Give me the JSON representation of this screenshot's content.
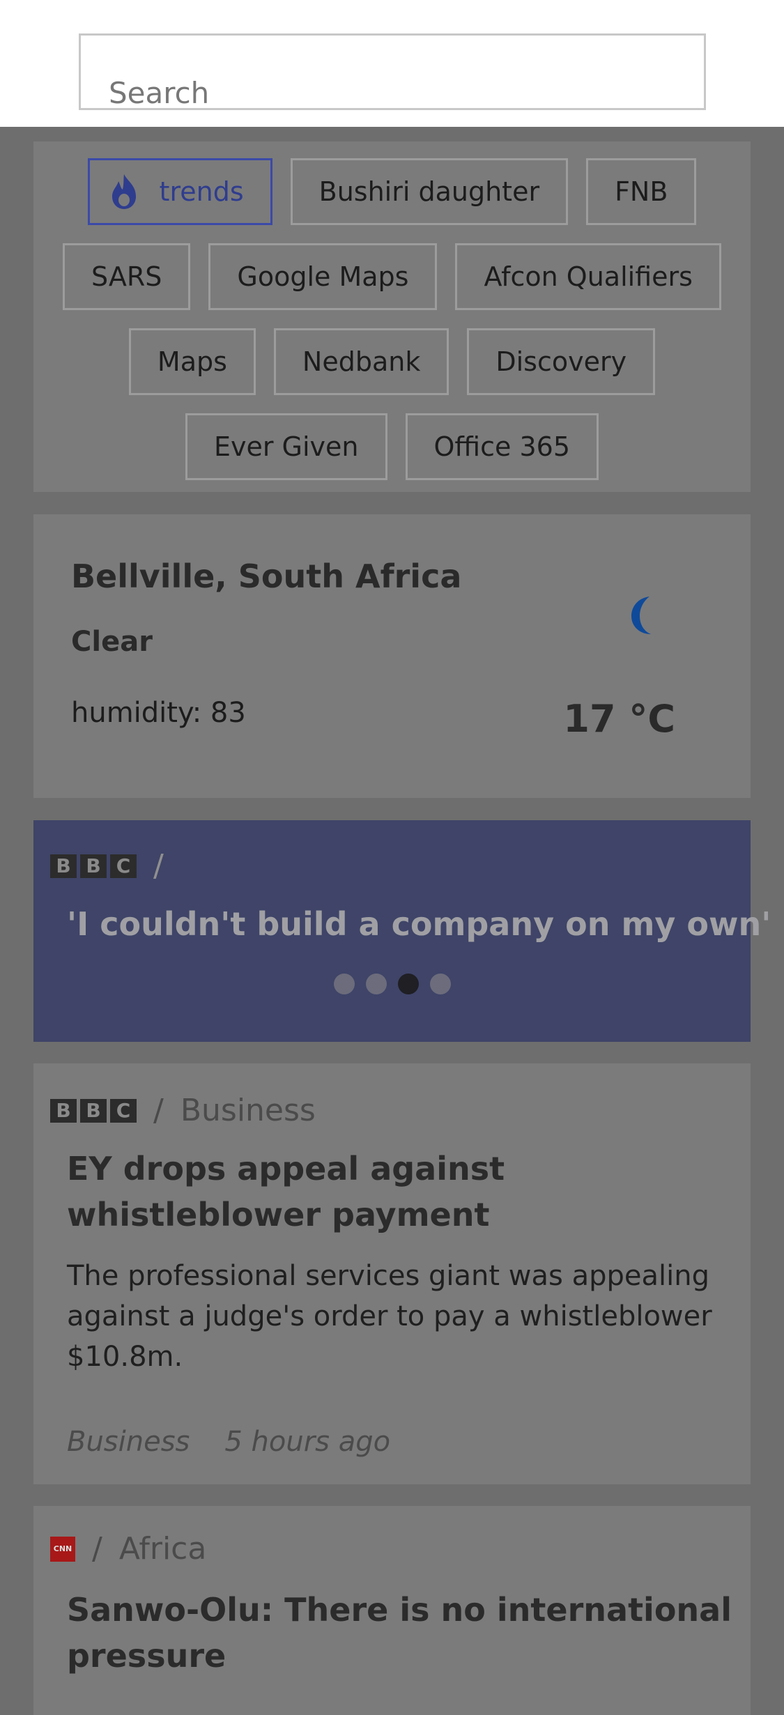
{
  "search": {
    "placeholder": "Search"
  },
  "trends": {
    "rows": [
      [
        {
          "label": "trends"
        },
        {
          "label": "Bushiri daughter"
        },
        {
          "label": "FNB"
        }
      ],
      [
        {
          "label": "SARS"
        },
        {
          "label": "Google Maps"
        },
        {
          "label": "Afcon Qualifiers"
        }
      ],
      [
        {
          "label": "Maps"
        },
        {
          "label": "Nedbank"
        },
        {
          "label": "Discovery"
        }
      ],
      [
        {
          "label": "Ever Given"
        },
        {
          "label": "Office 365"
        }
      ]
    ]
  },
  "weather": {
    "location": "Bellville, South Africa",
    "condition": "Clear",
    "humidity": "humidity: 83",
    "temperature": "17 °C",
    "icon": "crescent-moon-icon",
    "icon_color": "#0f4a9a"
  },
  "banner": {
    "source_logo": [
      "B",
      "B",
      "C"
    ],
    "slash": "/",
    "headline": "'I couldn't build a company on my own'",
    "dots_count": 4,
    "active_dot": 3
  },
  "article1": {
    "source_logo": [
      "B",
      "B",
      "C"
    ],
    "slash": "/",
    "section": "Business",
    "title": "EY drops appeal against whistleblower payment",
    "description": "The professional services giant was appealing against a judge's order to pay a whistleblower $10.8m.",
    "category": "Business",
    "time": "5 hours ago"
  },
  "article2": {
    "source_logo": "CNN",
    "slash": "/",
    "section": "Africa",
    "title": "Sanwo-Olu: There is no international pressure"
  },
  "colors": {
    "accent": "#3b4aa8",
    "banner_bg": "#3f4468",
    "overlay_bg": "#6e6e6e"
  }
}
